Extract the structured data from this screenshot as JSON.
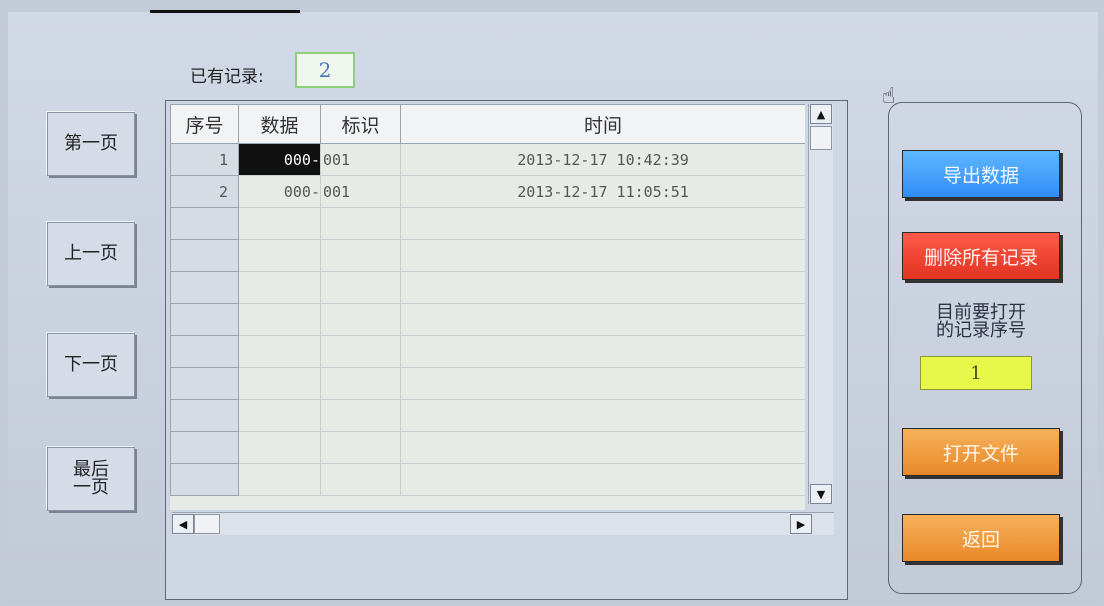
{
  "record_count": {
    "label": "已有记录:",
    "value": "2"
  },
  "nav": {
    "first": "第一页",
    "prev": "上一页",
    "next": "下一页",
    "last_line1": "最后",
    "last_line2": "一页"
  },
  "table": {
    "headers": [
      "序号",
      "数据",
      "标识",
      "时间"
    ],
    "rows": [
      {
        "index": "1",
        "data": "000-",
        "tag": "001",
        "time": "2013-12-17 10:42:39"
      },
      {
        "index": "2",
        "data": "000-",
        "tag": "001",
        "time": "2013-12-17 11:05:51"
      }
    ]
  },
  "panel": {
    "export_label": "导出数据",
    "delete_label": "删除所有记录",
    "open_index_label_line1": "目前要打开",
    "open_index_label_line2": "的记录序号",
    "open_index_value": "1",
    "open_file_label": "打开文件",
    "back_label": "返回"
  },
  "colors": {
    "export": "#2f8df5",
    "delete": "#e23322",
    "open": "#e8892a",
    "index_box": "#e8f84a"
  },
  "icons": {
    "cursor": "hand-pointer-icon"
  }
}
